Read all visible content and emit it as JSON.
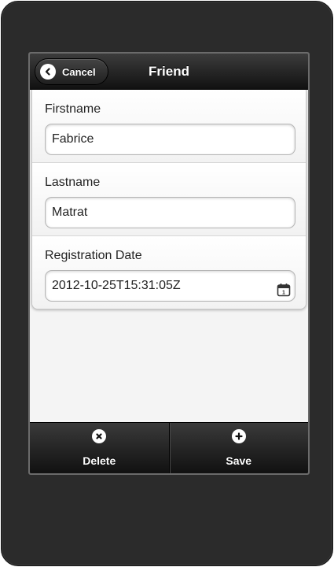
{
  "header": {
    "title": "Friend",
    "cancel_label": "Cancel",
    "cancel_icon": "arrow-left-icon"
  },
  "form": {
    "fields": [
      {
        "label": "Firstname",
        "value": "Fabrice"
      },
      {
        "label": "Lastname",
        "value": "Matrat"
      },
      {
        "label": "Registration Date",
        "value": "2012-10-25T15:31:05Z",
        "icon": "calendar-icon"
      }
    ]
  },
  "footer": {
    "delete_label": "Delete",
    "delete_icon": "delete-icon",
    "save_label": "Save",
    "save_icon": "plus-icon"
  }
}
